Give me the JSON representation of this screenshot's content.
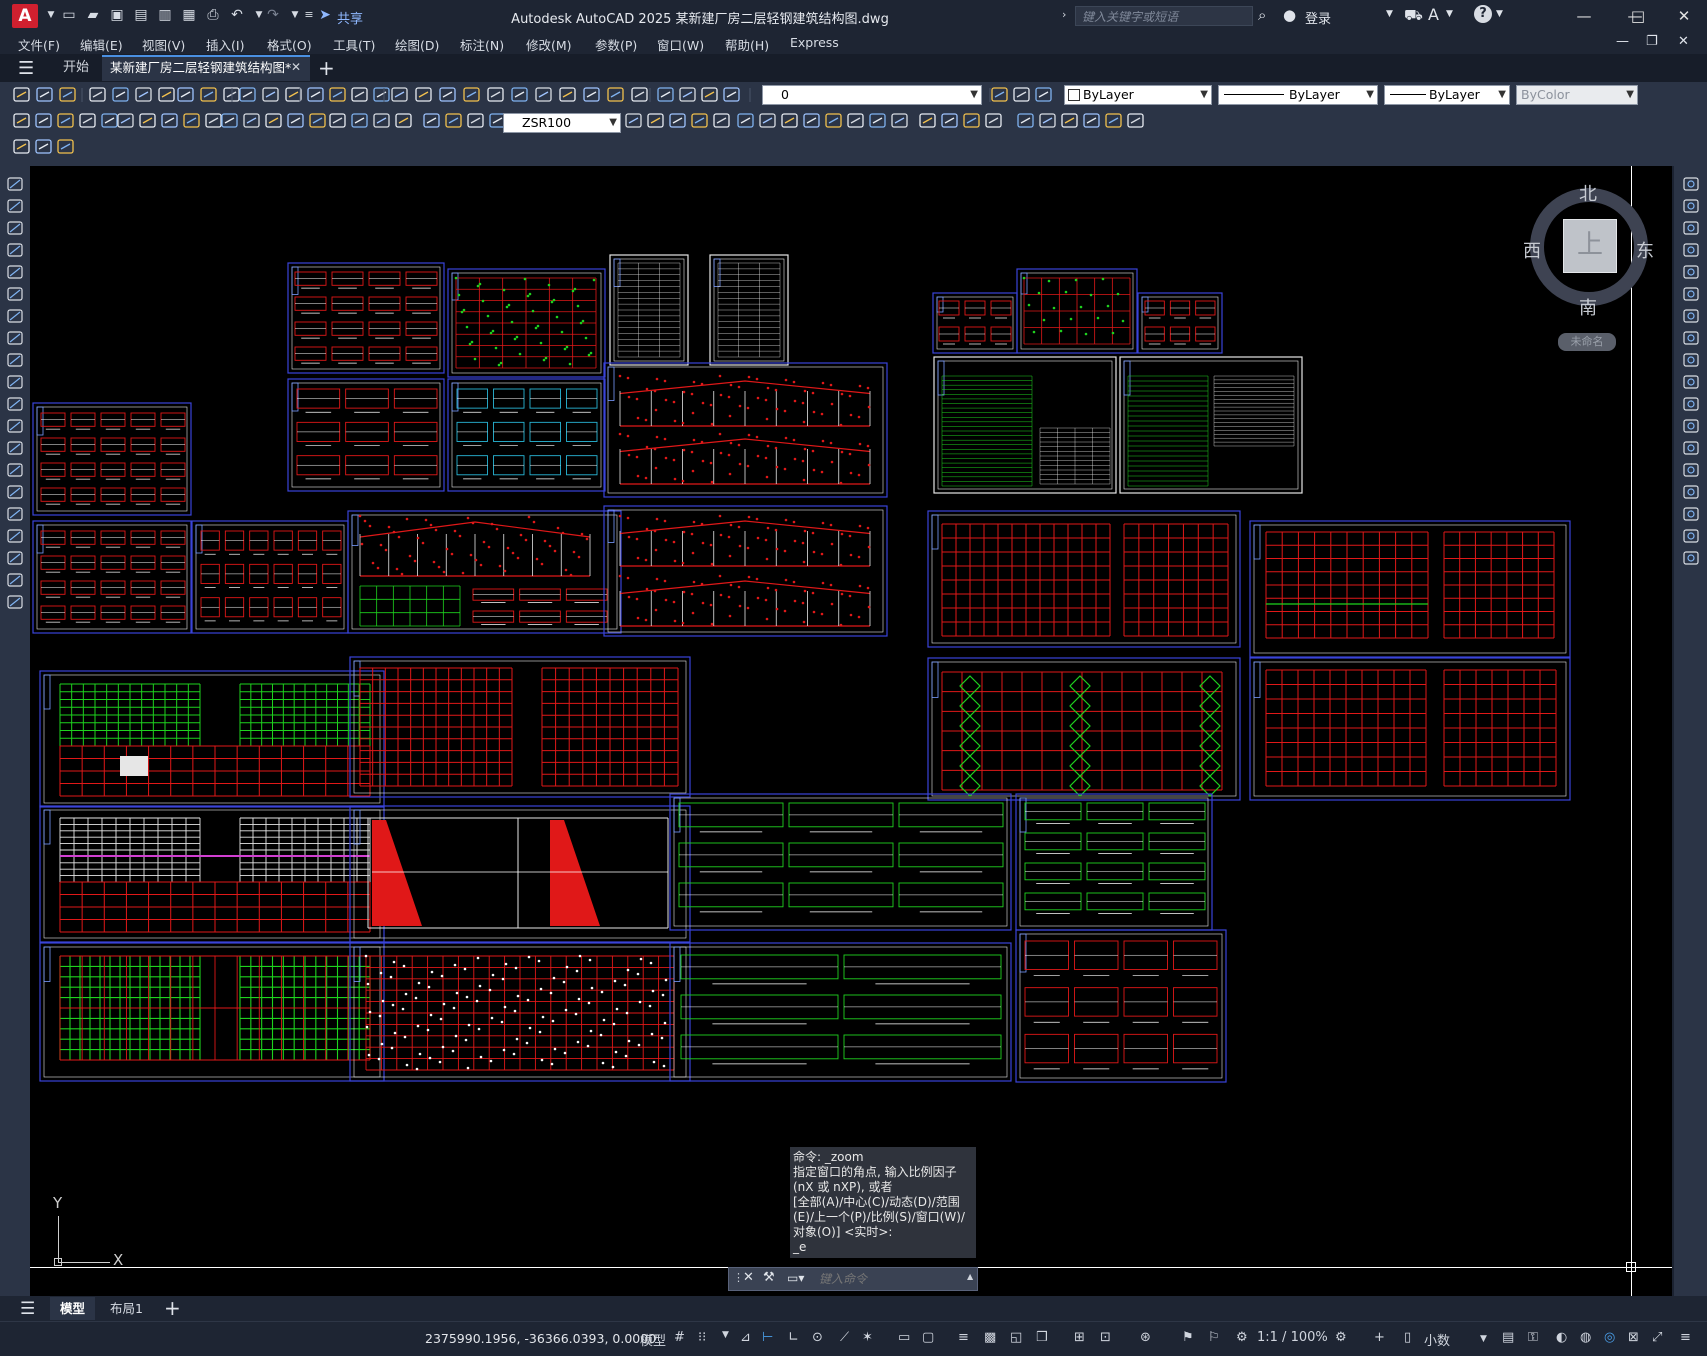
{
  "titlebar": {
    "app_logo": "A",
    "share_label": "共享",
    "title": "Autodesk AutoCAD 2025    某新建厂房二层轻钢建筑结构图.dwg",
    "search_placeholder": "键入关键字或短语",
    "login_label": "登录"
  },
  "menubar": {
    "items": [
      "文件(F)",
      "编辑(E)",
      "视图(V)",
      "插入(I)",
      "格式(O)",
      "工具(T)",
      "绘图(D)",
      "标注(N)",
      "修改(M)",
      "参数(P)",
      "窗口(W)",
      "帮助(H)",
      "Express"
    ]
  },
  "tabs": {
    "start": "开始",
    "document": "某新建厂房二层轻钢建筑结构图*"
  },
  "toolbar": {
    "layer_value": "0",
    "color_value": "ByLayer",
    "linetype_value": "ByLayer",
    "lineweight_value": "ByLayer",
    "plotstyle_value": "ByColor",
    "dimstyle_value": "ZSR100"
  },
  "viewcube": {
    "north": "北",
    "south": "南",
    "east": "东",
    "west": "西",
    "face": "上",
    "wcs": "未命名"
  },
  "ucs": {
    "x": "X",
    "y": "Y"
  },
  "command": {
    "history": "命令: _zoom\n指定窗口的角点, 输入比例因子 (nX 或 nXP), 或者\n[全部(A)/中心(C)/动态(D)/范围(E)/上一个(P)/比例(S)/窗口(W)/对象(O)] <实时>:\n_e",
    "placeholder": "键入命令"
  },
  "layout_tabs": {
    "model": "模型",
    "layout1": "布局1"
  },
  "statusbar": {
    "coordinates": "2375990.1956, -36366.0393, 0.0000",
    "model": "模型",
    "scale": "1:1 / 100%",
    "units": "小数"
  }
}
